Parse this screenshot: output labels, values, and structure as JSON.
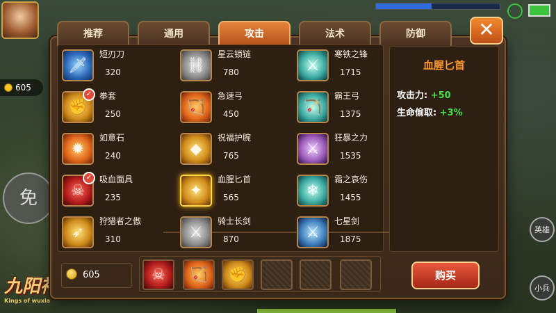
{
  "hud": {
    "gold": "605",
    "left_button": "免",
    "right_buttons": [
      "英雄",
      "小兵"
    ],
    "logo": "九阳神功",
    "logo_sub": "Kings of wuxia"
  },
  "tabs": [
    {
      "label": "推荐",
      "active": false
    },
    {
      "label": "通用",
      "active": false
    },
    {
      "label": "攻击",
      "active": true
    },
    {
      "label": "法术",
      "active": false
    },
    {
      "label": "防御",
      "active": false
    }
  ],
  "close_label": "✕",
  "items": [
    {
      "name": "短刃刀",
      "price": "320",
      "color": "c-blue",
      "icon": "dagger-icon",
      "glyph": "🗡",
      "owned": false
    },
    {
      "name": "星云锁链",
      "price": "780",
      "color": "c-grey",
      "icon": "chain-icon",
      "glyph": "⛓",
      "owned": false
    },
    {
      "name": "寒铁之锋",
      "price": "1715",
      "color": "c-teal",
      "icon": "axe-icon",
      "glyph": "⚔",
      "owned": false
    },
    {
      "name": "拳套",
      "price": "250",
      "color": "c-gold",
      "icon": "gauntlet-icon",
      "glyph": "✊",
      "owned": true
    },
    {
      "name": "急速弓",
      "price": "450",
      "color": "c-orange",
      "icon": "bow-icon",
      "glyph": "🏹",
      "owned": false
    },
    {
      "name": "霸王弓",
      "price": "1375",
      "color": "c-teal",
      "icon": "bow-icon",
      "glyph": "🏹",
      "owned": false
    },
    {
      "name": "如意石",
      "price": "240",
      "color": "c-orange",
      "icon": "stone-icon",
      "glyph": "✹",
      "owned": false
    },
    {
      "name": "祝福护腕",
      "price": "765",
      "color": "c-gold",
      "icon": "bracer-icon",
      "glyph": "◆",
      "owned": false
    },
    {
      "name": "狂暴之力",
      "price": "1535",
      "color": "c-purple",
      "icon": "sword-icon",
      "glyph": "⚔",
      "owned": false
    },
    {
      "name": "吸血面具",
      "price": "235",
      "color": "c-red",
      "icon": "mask-icon",
      "glyph": "☠",
      "owned": true
    },
    {
      "name": "血腥匕首",
      "price": "565",
      "color": "c-gold",
      "icon": "dagger-icon",
      "glyph": "✦",
      "owned": false,
      "selected": true
    },
    {
      "name": "霜之哀伤",
      "price": "1455",
      "color": "c-teal",
      "icon": "frost-sword-icon",
      "glyph": "❄",
      "owned": false
    },
    {
      "name": "狩猎者之傲",
      "price": "310",
      "color": "c-gold",
      "icon": "gun-icon",
      "glyph": "➶",
      "owned": false
    },
    {
      "name": "骑士长剑",
      "price": "870",
      "color": "c-grey",
      "icon": "sword-icon",
      "glyph": "⚔",
      "owned": false
    },
    {
      "name": "七星剑",
      "price": "1875",
      "color": "c-navy",
      "icon": "sword-icon",
      "glyph": "⚔",
      "owned": false
    }
  ],
  "detail": {
    "title": "血腥匕首",
    "stats": [
      {
        "label": "攻击力:",
        "value": "+50"
      },
      {
        "label": "生命偷取:",
        "value": "+3%"
      }
    ]
  },
  "gold_box": "605",
  "inventory": [
    {
      "icon": "mask-icon",
      "color": "c-red",
      "glyph": "☠"
    },
    {
      "icon": "bow-icon",
      "color": "c-orange",
      "glyph": "🏹"
    },
    {
      "icon": "gauntlet-icon",
      "color": "c-gold",
      "glyph": "✊"
    },
    {
      "icon": "empty-slot-icon"
    },
    {
      "icon": "empty-slot-icon"
    },
    {
      "icon": "empty-slot-icon"
    }
  ],
  "buy_label": "购买"
}
